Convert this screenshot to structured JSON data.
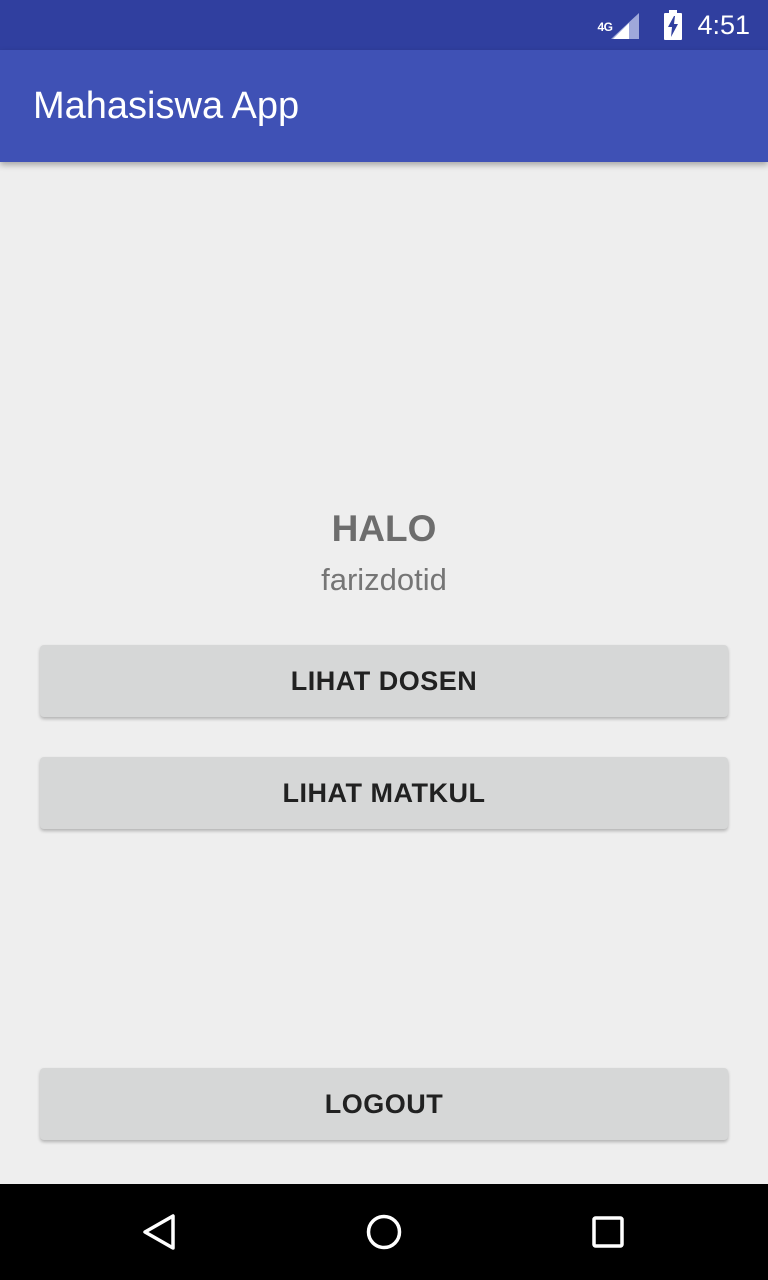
{
  "status_bar": {
    "network": "4G",
    "time": "4:51",
    "icons": [
      "signal-icon",
      "battery-charging-icon"
    ]
  },
  "app_bar": {
    "title": "Mahasiswa App",
    "color": "#3f51b5",
    "status_color": "#303f9f"
  },
  "main": {
    "greeting": "HALO",
    "username": "farizdotid",
    "buttons": {
      "lihat_dosen": "LIHAT DOSEN",
      "lihat_matkul": "LIHAT MATKUL",
      "logout": "LOGOUT"
    }
  },
  "nav_bar": {
    "icons": [
      "back-icon",
      "home-icon",
      "recent-apps-icon"
    ]
  }
}
